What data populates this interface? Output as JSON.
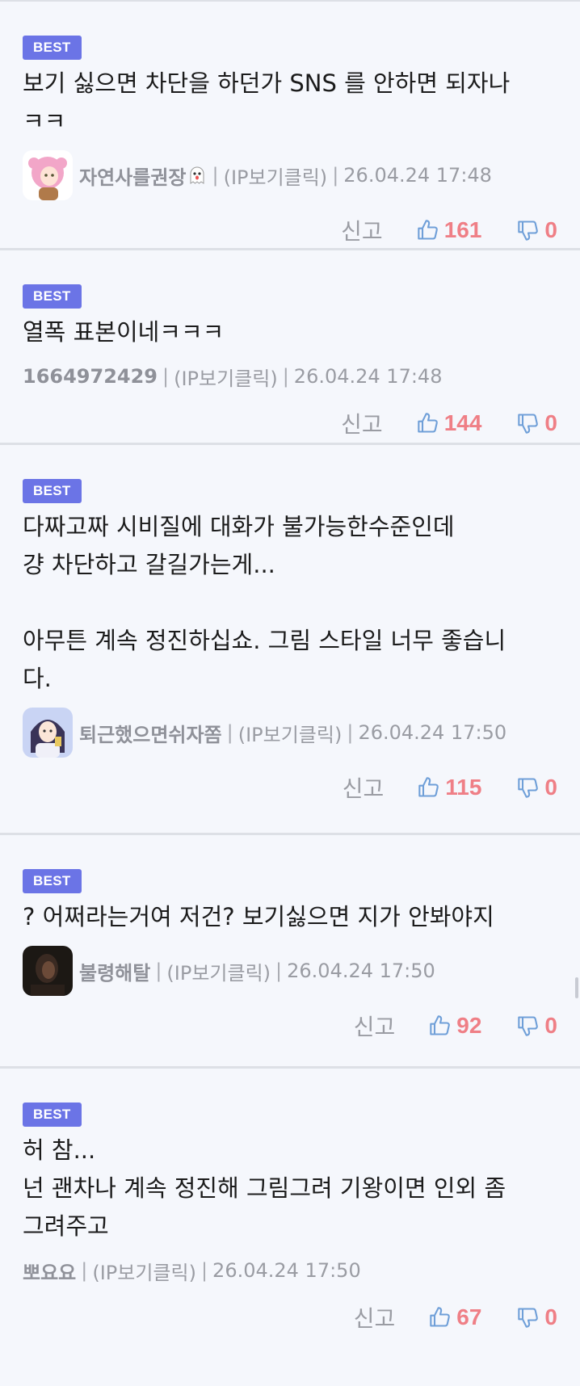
{
  "comments": [
    {
      "badge": "BEST",
      "text": "보기 싫으면 차단을 하던가 SNS 를 안하면 되자나\nㅋㅋ",
      "nick": "자연사를권장",
      "ip": "(IP보기클릭)",
      "date": "26.04.24 17:48",
      "report": "신고",
      "up": "161",
      "down": "0",
      "avatar": "pink-hair-avatar",
      "ghost_icon": "ghost-icon"
    },
    {
      "badge": "BEST",
      "text": "열폭 표본이네ㅋㅋㅋ",
      "nick": "1664972429",
      "ip": "(IP보기클릭)",
      "date": "26.04.24 17:48",
      "report": "신고",
      "up": "144",
      "down": "0"
    },
    {
      "badge": "BEST",
      "text": "다짜고짜 시비질에 대화가 불가능한수준인데\n걍 차단하고 갈길가는게...\n\n아무튼 계속 정진하십쇼. 그림 스타일 너무 좋습니\n다.",
      "nick": "퇴근했으면쉬자쫌",
      "ip": "(IP보기클릭)",
      "date": "26.04.24 17:50",
      "report": "신고",
      "up": "115",
      "down": "0",
      "avatar": "anime-girl-avatar"
    },
    {
      "badge": "BEST",
      "text": "? 어쩌라는거여 저건? 보기싫으면 지가 안봐야지",
      "nick": "불령해탈",
      "ip": "(IP보기클릭)",
      "date": "26.04.24 17:50",
      "report": "신고",
      "up": "92",
      "down": "0",
      "avatar": "dark-photo-avatar"
    },
    {
      "badge": "BEST",
      "text": "허 참...\n넌 괜차나 계속 정진해 그림그려 기왕이면 인외 좀\n그려주고",
      "nick": "뽀요요",
      "ip": "(IP보기클릭)",
      "date": "26.04.24 17:50",
      "report": "신고",
      "up": "67",
      "down": "0"
    }
  ],
  "colors": {
    "badge": "#6b74e6",
    "vote": "#ef7f86",
    "meta": "#9a9ca3",
    "background": "#f5f7fc"
  },
  "icons": {
    "up": "thumbs-up-icon",
    "down": "thumbs-down-icon"
  }
}
